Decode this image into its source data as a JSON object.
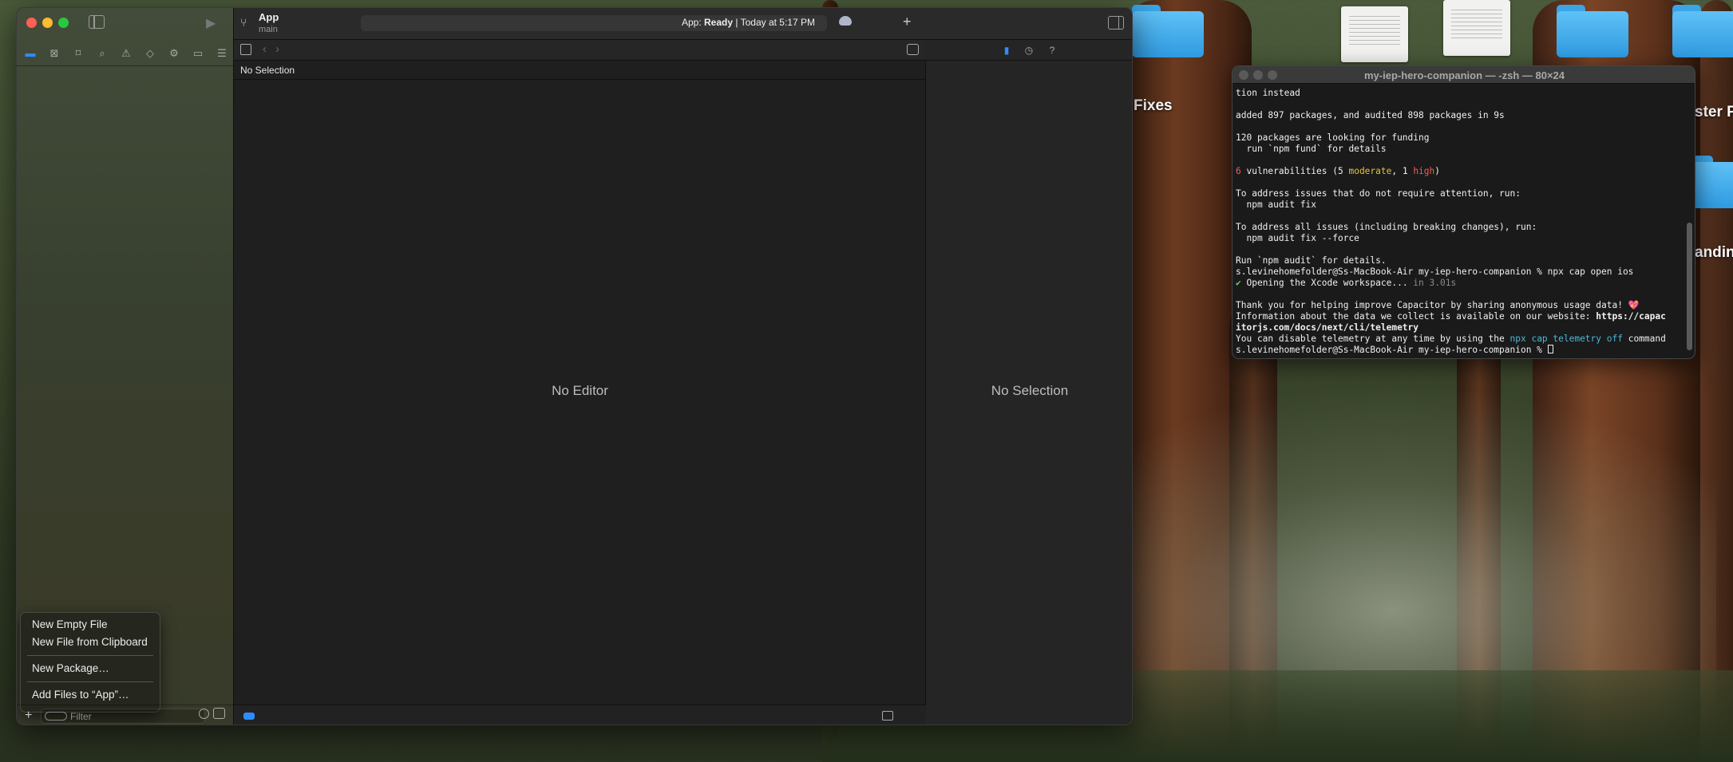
{
  "desktop": {
    "labels": [
      "Fixes",
      "ster P",
      "andin"
    ]
  },
  "xcode": {
    "project": {
      "name": "App",
      "branch": "main"
    },
    "status": {
      "prefix": "App: ",
      "state": "Ready",
      "suffix": " | Today at 5:17 PM"
    },
    "jump_bar": {
      "selection": "No Selection"
    },
    "editor_placeholder": "No Editor",
    "inspector_placeholder": "No Selection",
    "navigator_icons": [
      "folder-icon",
      "source-control-icon",
      "bookmark-icon",
      "find-icon",
      "issue-icon",
      "test-icon",
      "debug-icon",
      "breakpoint-icon",
      "report-icon"
    ],
    "new_file_menu": {
      "items": [
        "New Empty File",
        "New File from Clipboard",
        "New Package…",
        "Add Files to “App”…"
      ]
    },
    "filter": {
      "placeholder": "Filter",
      "value": ""
    },
    "colors": {
      "accent": "#2f8cff"
    }
  },
  "terminal": {
    "title": "my-iep-hero-companion — -zsh — 80×24",
    "lines": [
      {
        "segments": [
          {
            "text": "tion instead",
            "style": ""
          }
        ]
      },
      {
        "segments": [
          {
            "text": "",
            "style": ""
          }
        ]
      },
      {
        "segments": [
          {
            "text": "added 897 packages, and audited 898 packages in 9s",
            "style": ""
          }
        ]
      },
      {
        "segments": [
          {
            "text": "",
            "style": ""
          }
        ]
      },
      {
        "segments": [
          {
            "text": "120 packages are looking for funding",
            "style": ""
          }
        ]
      },
      {
        "segments": [
          {
            "text": "  run `npm fund` for details",
            "style": ""
          }
        ]
      },
      {
        "segments": [
          {
            "text": "",
            "style": ""
          }
        ]
      },
      {
        "segments": [
          {
            "text": "6",
            "style": "red"
          },
          {
            "text": " vulnerabilities (5 ",
            "style": ""
          },
          {
            "text": "moderate",
            "style": "yellow"
          },
          {
            "text": ", 1 ",
            "style": ""
          },
          {
            "text": "high",
            "style": "red"
          },
          {
            "text": ")",
            "style": ""
          }
        ]
      },
      {
        "segments": [
          {
            "text": "",
            "style": ""
          }
        ]
      },
      {
        "segments": [
          {
            "text": "To address issues that do not require attention, run:",
            "style": ""
          }
        ]
      },
      {
        "segments": [
          {
            "text": "  npm audit fix",
            "style": ""
          }
        ]
      },
      {
        "segments": [
          {
            "text": "",
            "style": ""
          }
        ]
      },
      {
        "segments": [
          {
            "text": "To address all issues (including breaking changes), run:",
            "style": ""
          }
        ]
      },
      {
        "segments": [
          {
            "text": "  npm audit fix --force",
            "style": ""
          }
        ]
      },
      {
        "segments": [
          {
            "text": "",
            "style": ""
          }
        ]
      },
      {
        "segments": [
          {
            "text": "Run `npm audit` for details.",
            "style": ""
          }
        ]
      },
      {
        "segments": [
          {
            "text": "s.levinehomefolder@Ss-MacBook-Air my-iep-hero-companion % npx cap open ios",
            "style": ""
          }
        ]
      },
      {
        "segments": [
          {
            "text": "✔",
            "style": "green"
          },
          {
            "text": " Opening the Xcode workspace... ",
            "style": ""
          },
          {
            "text": "in 3.01s",
            "style": "dim"
          }
        ]
      },
      {
        "segments": [
          {
            "text": "",
            "style": ""
          }
        ]
      },
      {
        "segments": [
          {
            "text": "Thank you for helping improve Capacitor by sharing anonymous usage data! ",
            "style": ""
          },
          {
            "text": "💖",
            "style": "red"
          }
        ]
      },
      {
        "segments": [
          {
            "text": "Information about the data we collect is available on our website: ",
            "style": ""
          },
          {
            "text": "https://capac",
            "style": "bold"
          }
        ]
      },
      {
        "segments": [
          {
            "text": "itorjs.com/docs/next/cli/telemetry",
            "style": "bold"
          }
        ]
      },
      {
        "segments": [
          {
            "text": "You can disable telemetry at any time by using the ",
            "style": ""
          },
          {
            "text": "npx cap telemetry off",
            "style": "cyan"
          },
          {
            "text": " command",
            "style": ""
          }
        ]
      },
      {
        "segments": [
          {
            "text": "s.levinehomefolder@Ss-MacBook-Air my-iep-hero-companion % ",
            "style": ""
          }
        ]
      }
    ]
  }
}
